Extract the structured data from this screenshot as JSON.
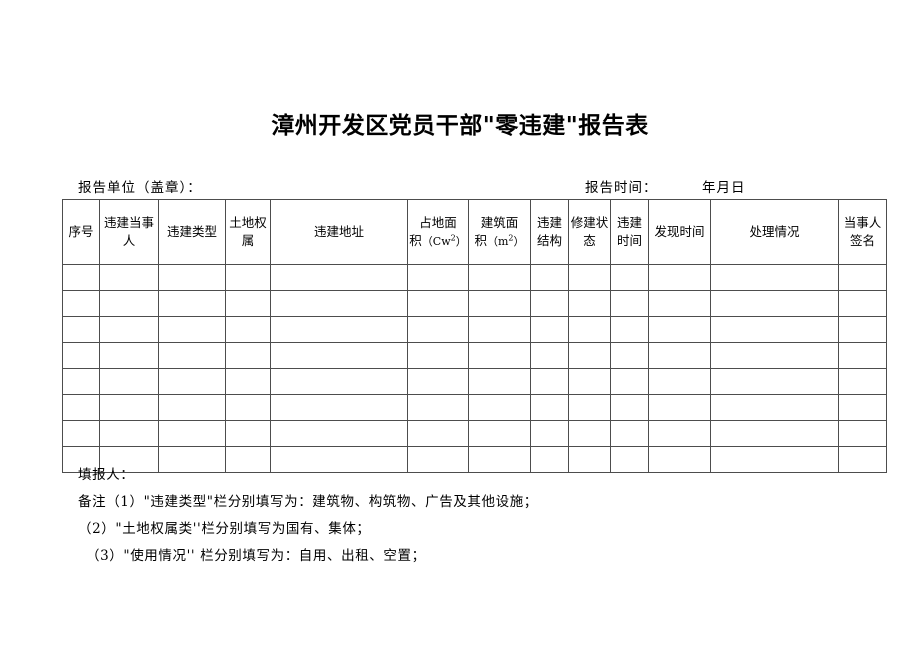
{
  "document": {
    "title": "漳州开发区党员干部\"零违建\"报告表"
  },
  "meta": {
    "report_unit_label": "报告单位（盖章）：",
    "report_time_label": "报告时间：",
    "report_time_value": "年月日"
  },
  "table": {
    "columns": [
      {
        "key": "seq",
        "label": "序号"
      },
      {
        "key": "party",
        "label": "违建当事人"
      },
      {
        "key": "violation_type",
        "label": "违建类型"
      },
      {
        "key": "land_title",
        "label": "土地权属"
      },
      {
        "key": "address",
        "label": "违建地址"
      },
      {
        "key": "land_area",
        "label": "占地面积（Cw2）"
      },
      {
        "key": "floor_area",
        "label": "建筑面积（m2）"
      },
      {
        "key": "structure",
        "label": "违建结构"
      },
      {
        "key": "build_state",
        "label": "修建状态"
      },
      {
        "key": "build_time",
        "label": "违建时间"
      },
      {
        "key": "found_time",
        "label": "发现时间"
      },
      {
        "key": "handling",
        "label": "处理情况"
      },
      {
        "key": "signature",
        "label": "当事人签名"
      }
    ],
    "row_count": 8,
    "rows": [
      {
        "seq": "",
        "party": "",
        "violation_type": "",
        "land_title": "",
        "address": "",
        "land_area": "",
        "floor_area": "",
        "structure": "",
        "build_state": "",
        "build_time": "",
        "found_time": "",
        "handling": "",
        "signature": ""
      },
      {
        "seq": "",
        "party": "",
        "violation_type": "",
        "land_title": "",
        "address": "",
        "land_area": "",
        "floor_area": "",
        "structure": "",
        "build_state": "",
        "build_time": "",
        "found_time": "",
        "handling": "",
        "signature": ""
      },
      {
        "seq": "",
        "party": "",
        "violation_type": "",
        "land_title": "",
        "address": "",
        "land_area": "",
        "floor_area": "",
        "structure": "",
        "build_state": "",
        "build_time": "",
        "found_time": "",
        "handling": "",
        "signature": ""
      },
      {
        "seq": "",
        "party": "",
        "violation_type": "",
        "land_title": "",
        "address": "",
        "land_area": "",
        "floor_area": "",
        "structure": "",
        "build_state": "",
        "build_time": "",
        "found_time": "",
        "handling": "",
        "signature": ""
      },
      {
        "seq": "",
        "party": "",
        "violation_type": "",
        "land_title": "",
        "address": "",
        "land_area": "",
        "floor_area": "",
        "structure": "",
        "build_state": "",
        "build_time": "",
        "found_time": "",
        "handling": "",
        "signature": ""
      },
      {
        "seq": "",
        "party": "",
        "violation_type": "",
        "land_title": "",
        "address": "",
        "land_area": "",
        "floor_area": "",
        "structure": "",
        "build_state": "",
        "build_time": "",
        "found_time": "",
        "handling": "",
        "signature": ""
      },
      {
        "seq": "",
        "party": "",
        "violation_type": "",
        "land_title": "",
        "address": "",
        "land_area": "",
        "floor_area": "",
        "structure": "",
        "build_state": "",
        "build_time": "",
        "found_time": "",
        "handling": "",
        "signature": ""
      },
      {
        "seq": "",
        "party": "",
        "violation_type": "",
        "land_title": "",
        "address": "",
        "land_area": "",
        "floor_area": "",
        "structure": "",
        "build_state": "",
        "build_time": "",
        "found_time": "",
        "handling": "",
        "signature": ""
      }
    ]
  },
  "notes": {
    "filler_label": "填报人：",
    "note_1": "备注（1）\"违建类型\"栏分别填写为：建筑物、构筑物、广告及其他设施；",
    "note_2": "（2）\"土地权属类''栏分别填写为国有、集体；",
    "note_3": "（3）\"使用情况'' 栏分别填写为：自用、出租、空置；"
  },
  "colors": {
    "page_background": "#ffffff",
    "text": "#000000",
    "table_border": "#4d4d4d"
  }
}
